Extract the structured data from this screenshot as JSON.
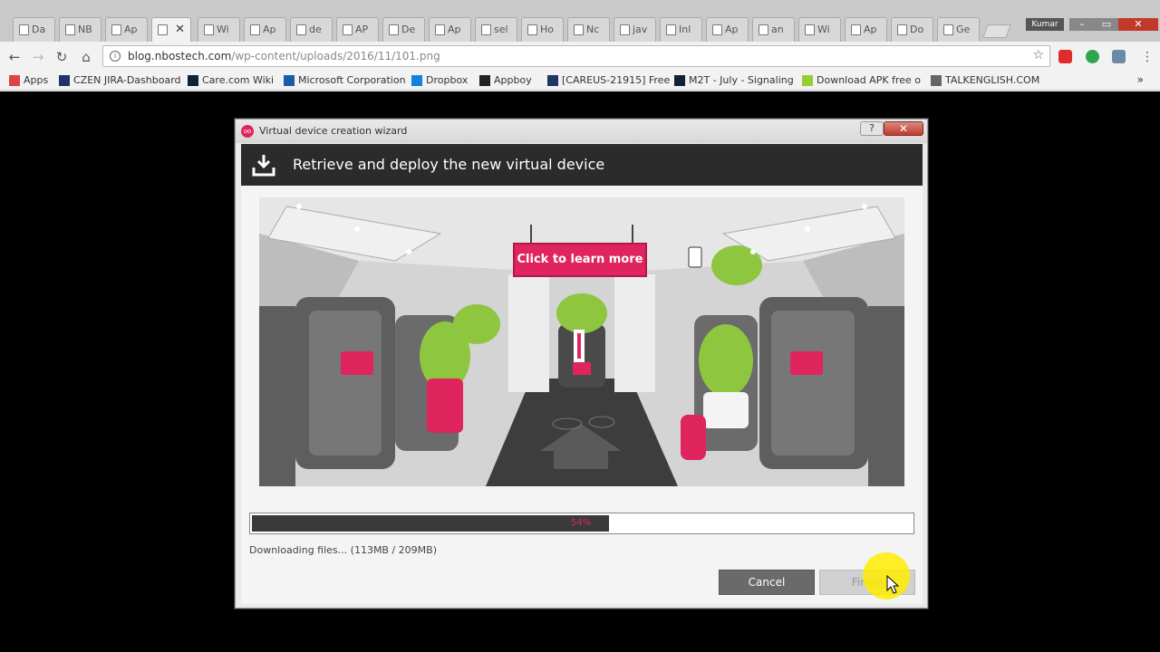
{
  "browser": {
    "tabs": [
      {
        "label": "Da",
        "icon": "page-icon"
      },
      {
        "label": "NB",
        "icon": "page-icon"
      },
      {
        "label": "Ap",
        "icon": "page-icon"
      },
      {
        "label": "",
        "icon": "page-icon",
        "active": true
      },
      {
        "label": "Wi",
        "icon": "book-icon"
      },
      {
        "label": "Ap",
        "icon": "app-icon"
      },
      {
        "label": "de",
        "icon": "google-icon"
      },
      {
        "label": "AP",
        "icon": "page-icon"
      },
      {
        "label": "De",
        "icon": "book-icon"
      },
      {
        "label": "Ap",
        "icon": "cloud-icon"
      },
      {
        "label": "sel",
        "icon": "sketch-icon"
      },
      {
        "label": "Ho",
        "icon": "sketch-icon"
      },
      {
        "label": "Nc",
        "icon": "app-icon"
      },
      {
        "label": "jav",
        "icon": "sketch-icon"
      },
      {
        "label": "Inl",
        "icon": "gmail-icon"
      },
      {
        "label": "Ap",
        "icon": "docs-icon"
      },
      {
        "label": "an",
        "icon": "google-icon"
      },
      {
        "label": "Wi",
        "icon": "app-icon"
      },
      {
        "label": "Ap",
        "icon": "sketch-icon"
      },
      {
        "label": "Do",
        "icon": "android-icon"
      },
      {
        "label": "Ge",
        "icon": "genymotion-icon"
      }
    ],
    "close_glyph": "✕",
    "profile_name": "Kumar",
    "url_host": "blog.nbostech.com",
    "url_path": "/wp-content/uploads/2016/11/101.png",
    "bookmarks": [
      {
        "label": "Apps"
      },
      {
        "label": "CZEN JIRA-Dashboard"
      },
      {
        "label": "Care.com Wiki"
      },
      {
        "label": "Microsoft Corporation"
      },
      {
        "label": "Dropbox"
      },
      {
        "label": "Appboy"
      },
      {
        "label": "[CAREUS-21915] Free"
      },
      {
        "label": "M2T - July - Signaling"
      },
      {
        "label": "Download APK free o"
      },
      {
        "label": "TALKENGLISH.COM"
      }
    ],
    "bookmarks_more": "»"
  },
  "dialog": {
    "window_title": "Virtual device creation wizard",
    "help_label": "?",
    "close_label": "✕",
    "heading": "Retrieve and deploy the new virtual device",
    "learn_more_label": "Click to learn more",
    "progress_percent": 54,
    "progress_label": "54%",
    "status_text": "Downloading files... (113MB / 209MB)",
    "cancel_label": "Cancel",
    "finish_label": "Finish",
    "accent_color": "#e0245e"
  }
}
